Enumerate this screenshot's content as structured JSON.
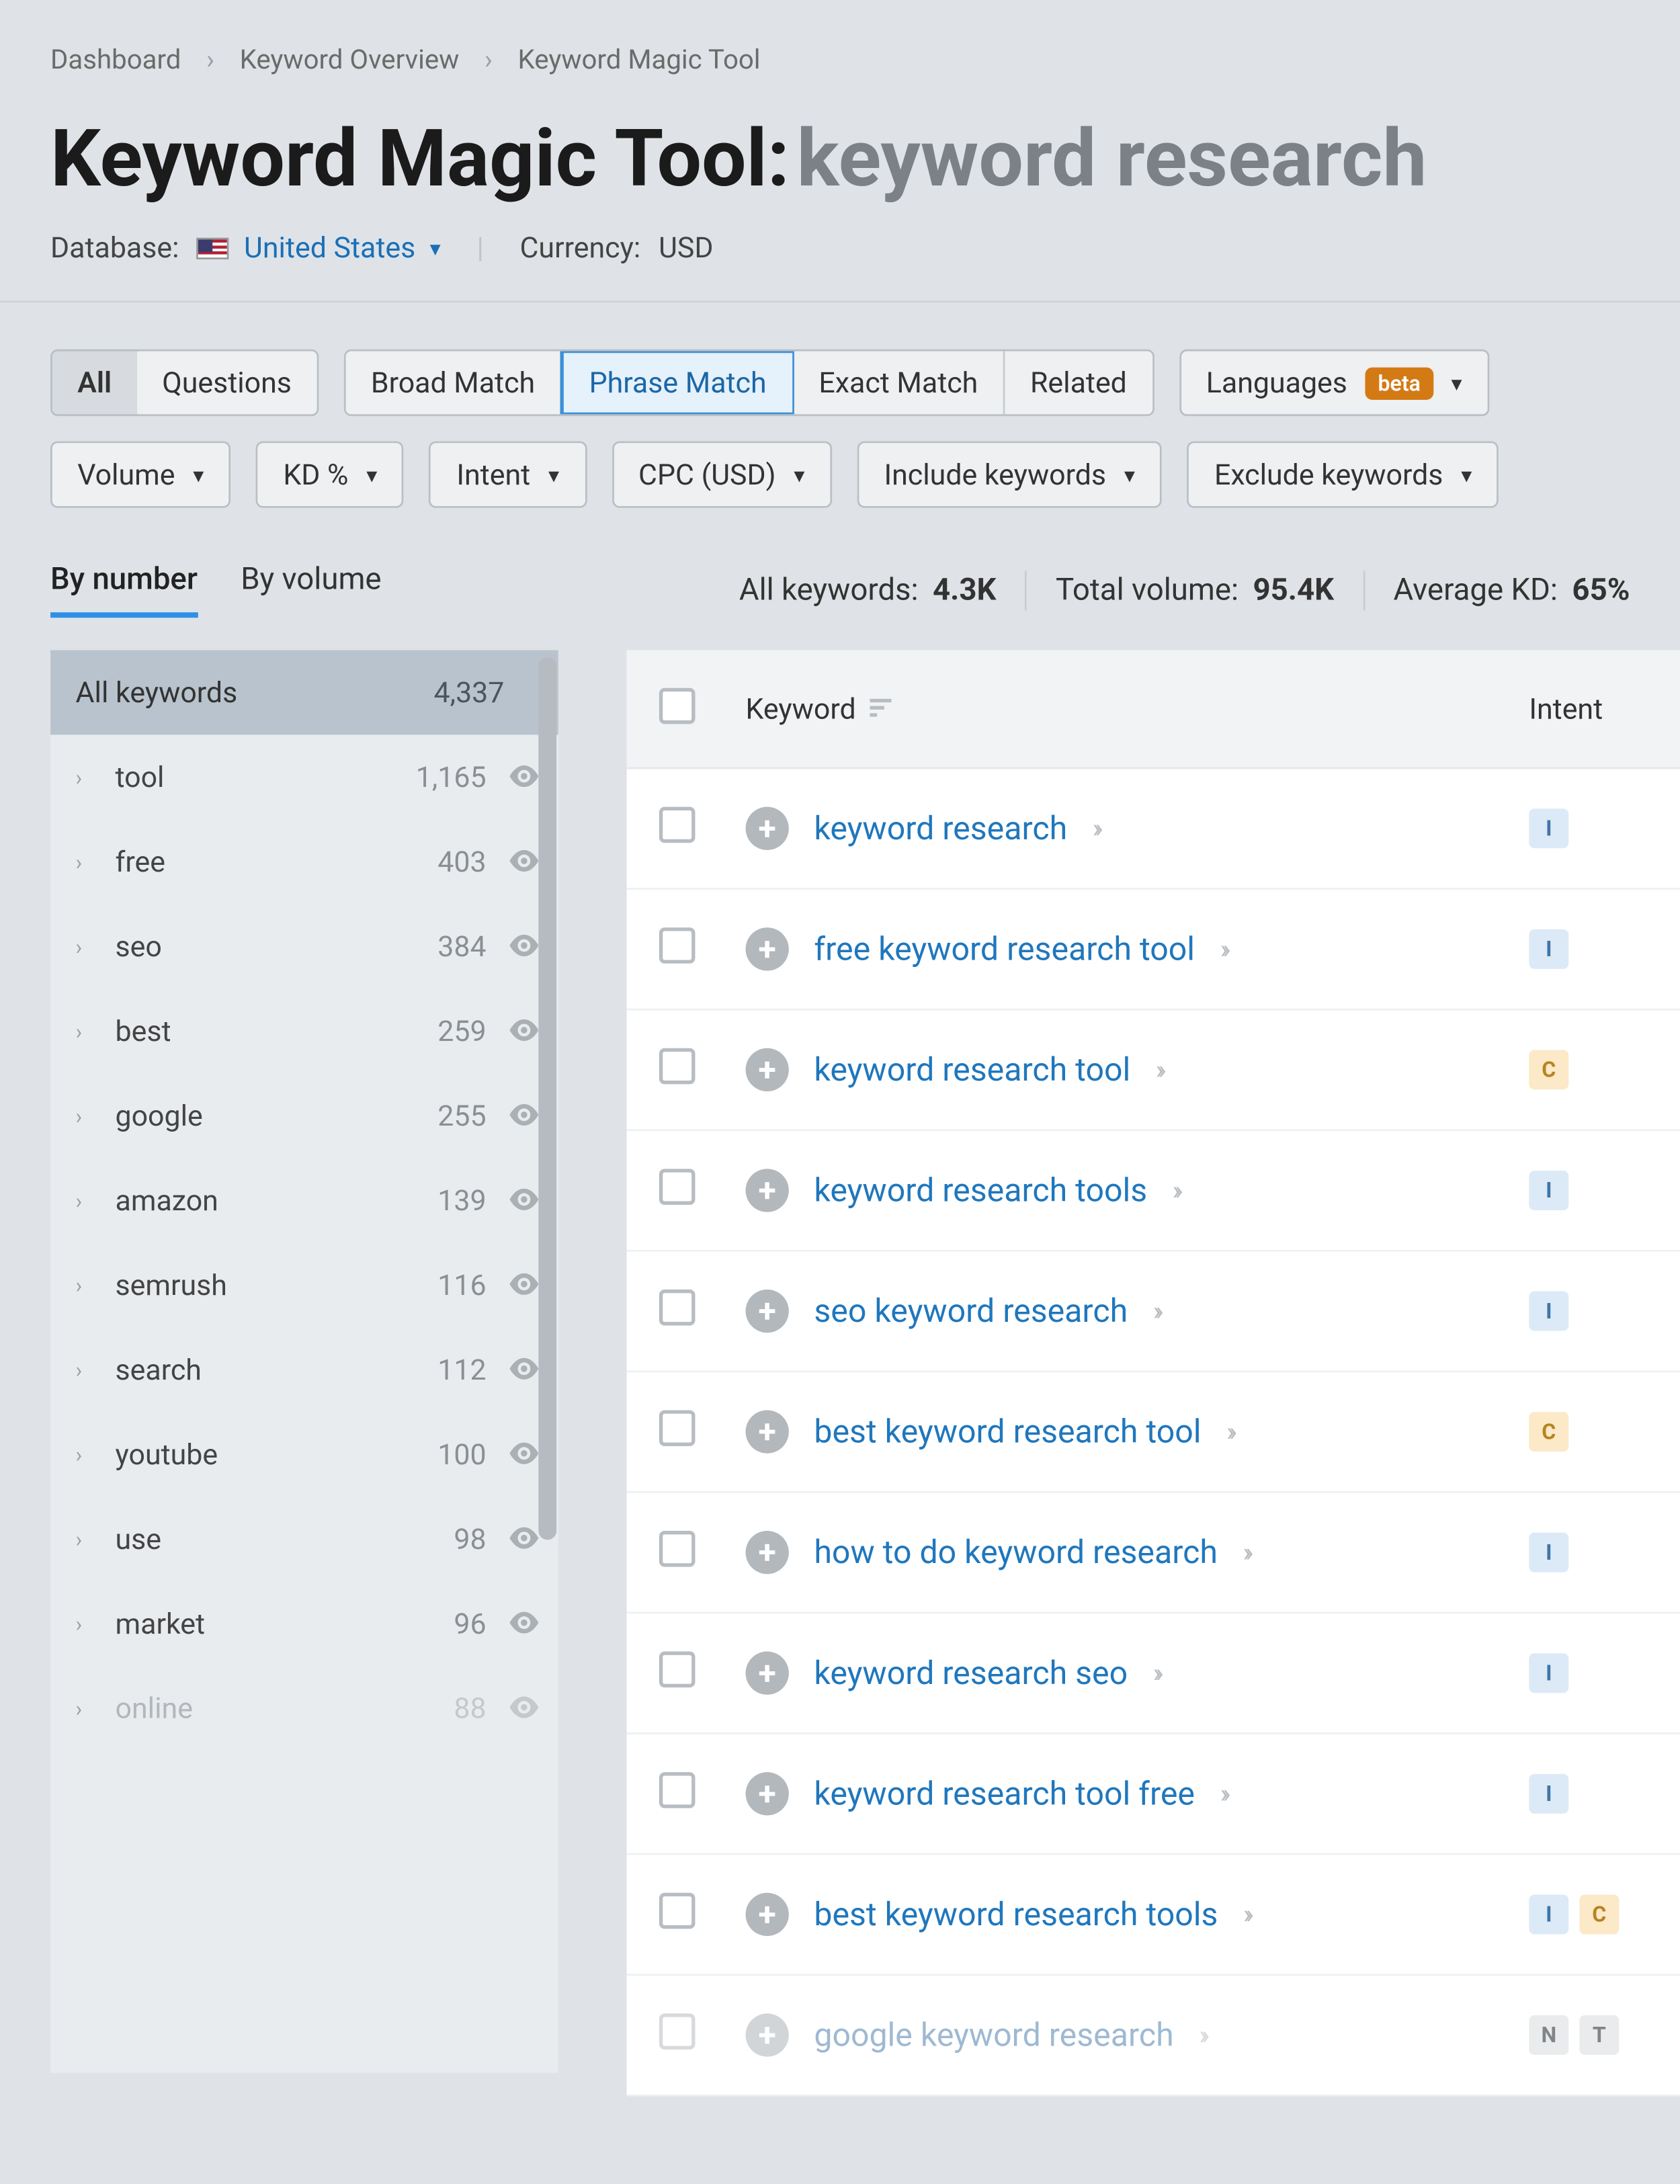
{
  "breadcrumb": [
    "Dashboard",
    "Keyword Overview",
    "Keyword Magic Tool"
  ],
  "title": {
    "tool": "Keyword Magic Tool:",
    "query": "keyword research"
  },
  "database": {
    "label": "Database:",
    "value": "United States"
  },
  "currency": {
    "label": "Currency:",
    "value": "USD"
  },
  "match_group_a": {
    "all": "All",
    "questions": "Questions"
  },
  "match_group_b": {
    "broad": "Broad Match",
    "phrase": "Phrase Match",
    "exact": "Exact Match",
    "related": "Related"
  },
  "languages": {
    "label": "Languages",
    "badge": "beta"
  },
  "filters": {
    "volume": "Volume",
    "kd": "KD %",
    "intent": "Intent",
    "cpc": "CPC (USD)",
    "include": "Include keywords",
    "exclude": "Exclude keywords"
  },
  "sort": {
    "bynumber": "By number",
    "byvolume": "By volume"
  },
  "metrics": {
    "all_label": "All keywords:",
    "all_value": "4.3K",
    "vol_label": "Total volume:",
    "vol_value": "95.4K",
    "kd_label": "Average KD:",
    "kd_value": "65%"
  },
  "sidebar": {
    "header_label": "All keywords",
    "header_count": "4,337",
    "items": [
      {
        "name": "tool",
        "count": "1,165"
      },
      {
        "name": "free",
        "count": "403"
      },
      {
        "name": "seo",
        "count": "384"
      },
      {
        "name": "best",
        "count": "259"
      },
      {
        "name": "google",
        "count": "255"
      },
      {
        "name": "amazon",
        "count": "139"
      },
      {
        "name": "semrush",
        "count": "116"
      },
      {
        "name": "search",
        "count": "112"
      },
      {
        "name": "youtube",
        "count": "100"
      },
      {
        "name": "use",
        "count": "98"
      },
      {
        "name": "market",
        "count": "96"
      },
      {
        "name": "online",
        "count": "88",
        "faded": true
      }
    ]
  },
  "table": {
    "col_keyword": "Keyword",
    "col_intent": "Intent",
    "rows": [
      {
        "kw": "keyword research",
        "intents": [
          "I"
        ]
      },
      {
        "kw": "free keyword research tool",
        "intents": [
          "I"
        ]
      },
      {
        "kw": "keyword research tool",
        "intents": [
          "C"
        ]
      },
      {
        "kw": "keyword research tools",
        "intents": [
          "I"
        ]
      },
      {
        "kw": "seo keyword research",
        "intents": [
          "I"
        ]
      },
      {
        "kw": "best keyword research tool",
        "intents": [
          "C"
        ]
      },
      {
        "kw": "how to do keyword research",
        "intents": [
          "I"
        ]
      },
      {
        "kw": "keyword research seo",
        "intents": [
          "I"
        ]
      },
      {
        "kw": "keyword research tool free",
        "intents": [
          "I"
        ]
      },
      {
        "kw": "best keyword research tools",
        "intents": [
          "I",
          "C"
        ]
      },
      {
        "kw": "google keyword research",
        "intents": [
          "N",
          "T"
        ],
        "faded": true
      }
    ]
  }
}
